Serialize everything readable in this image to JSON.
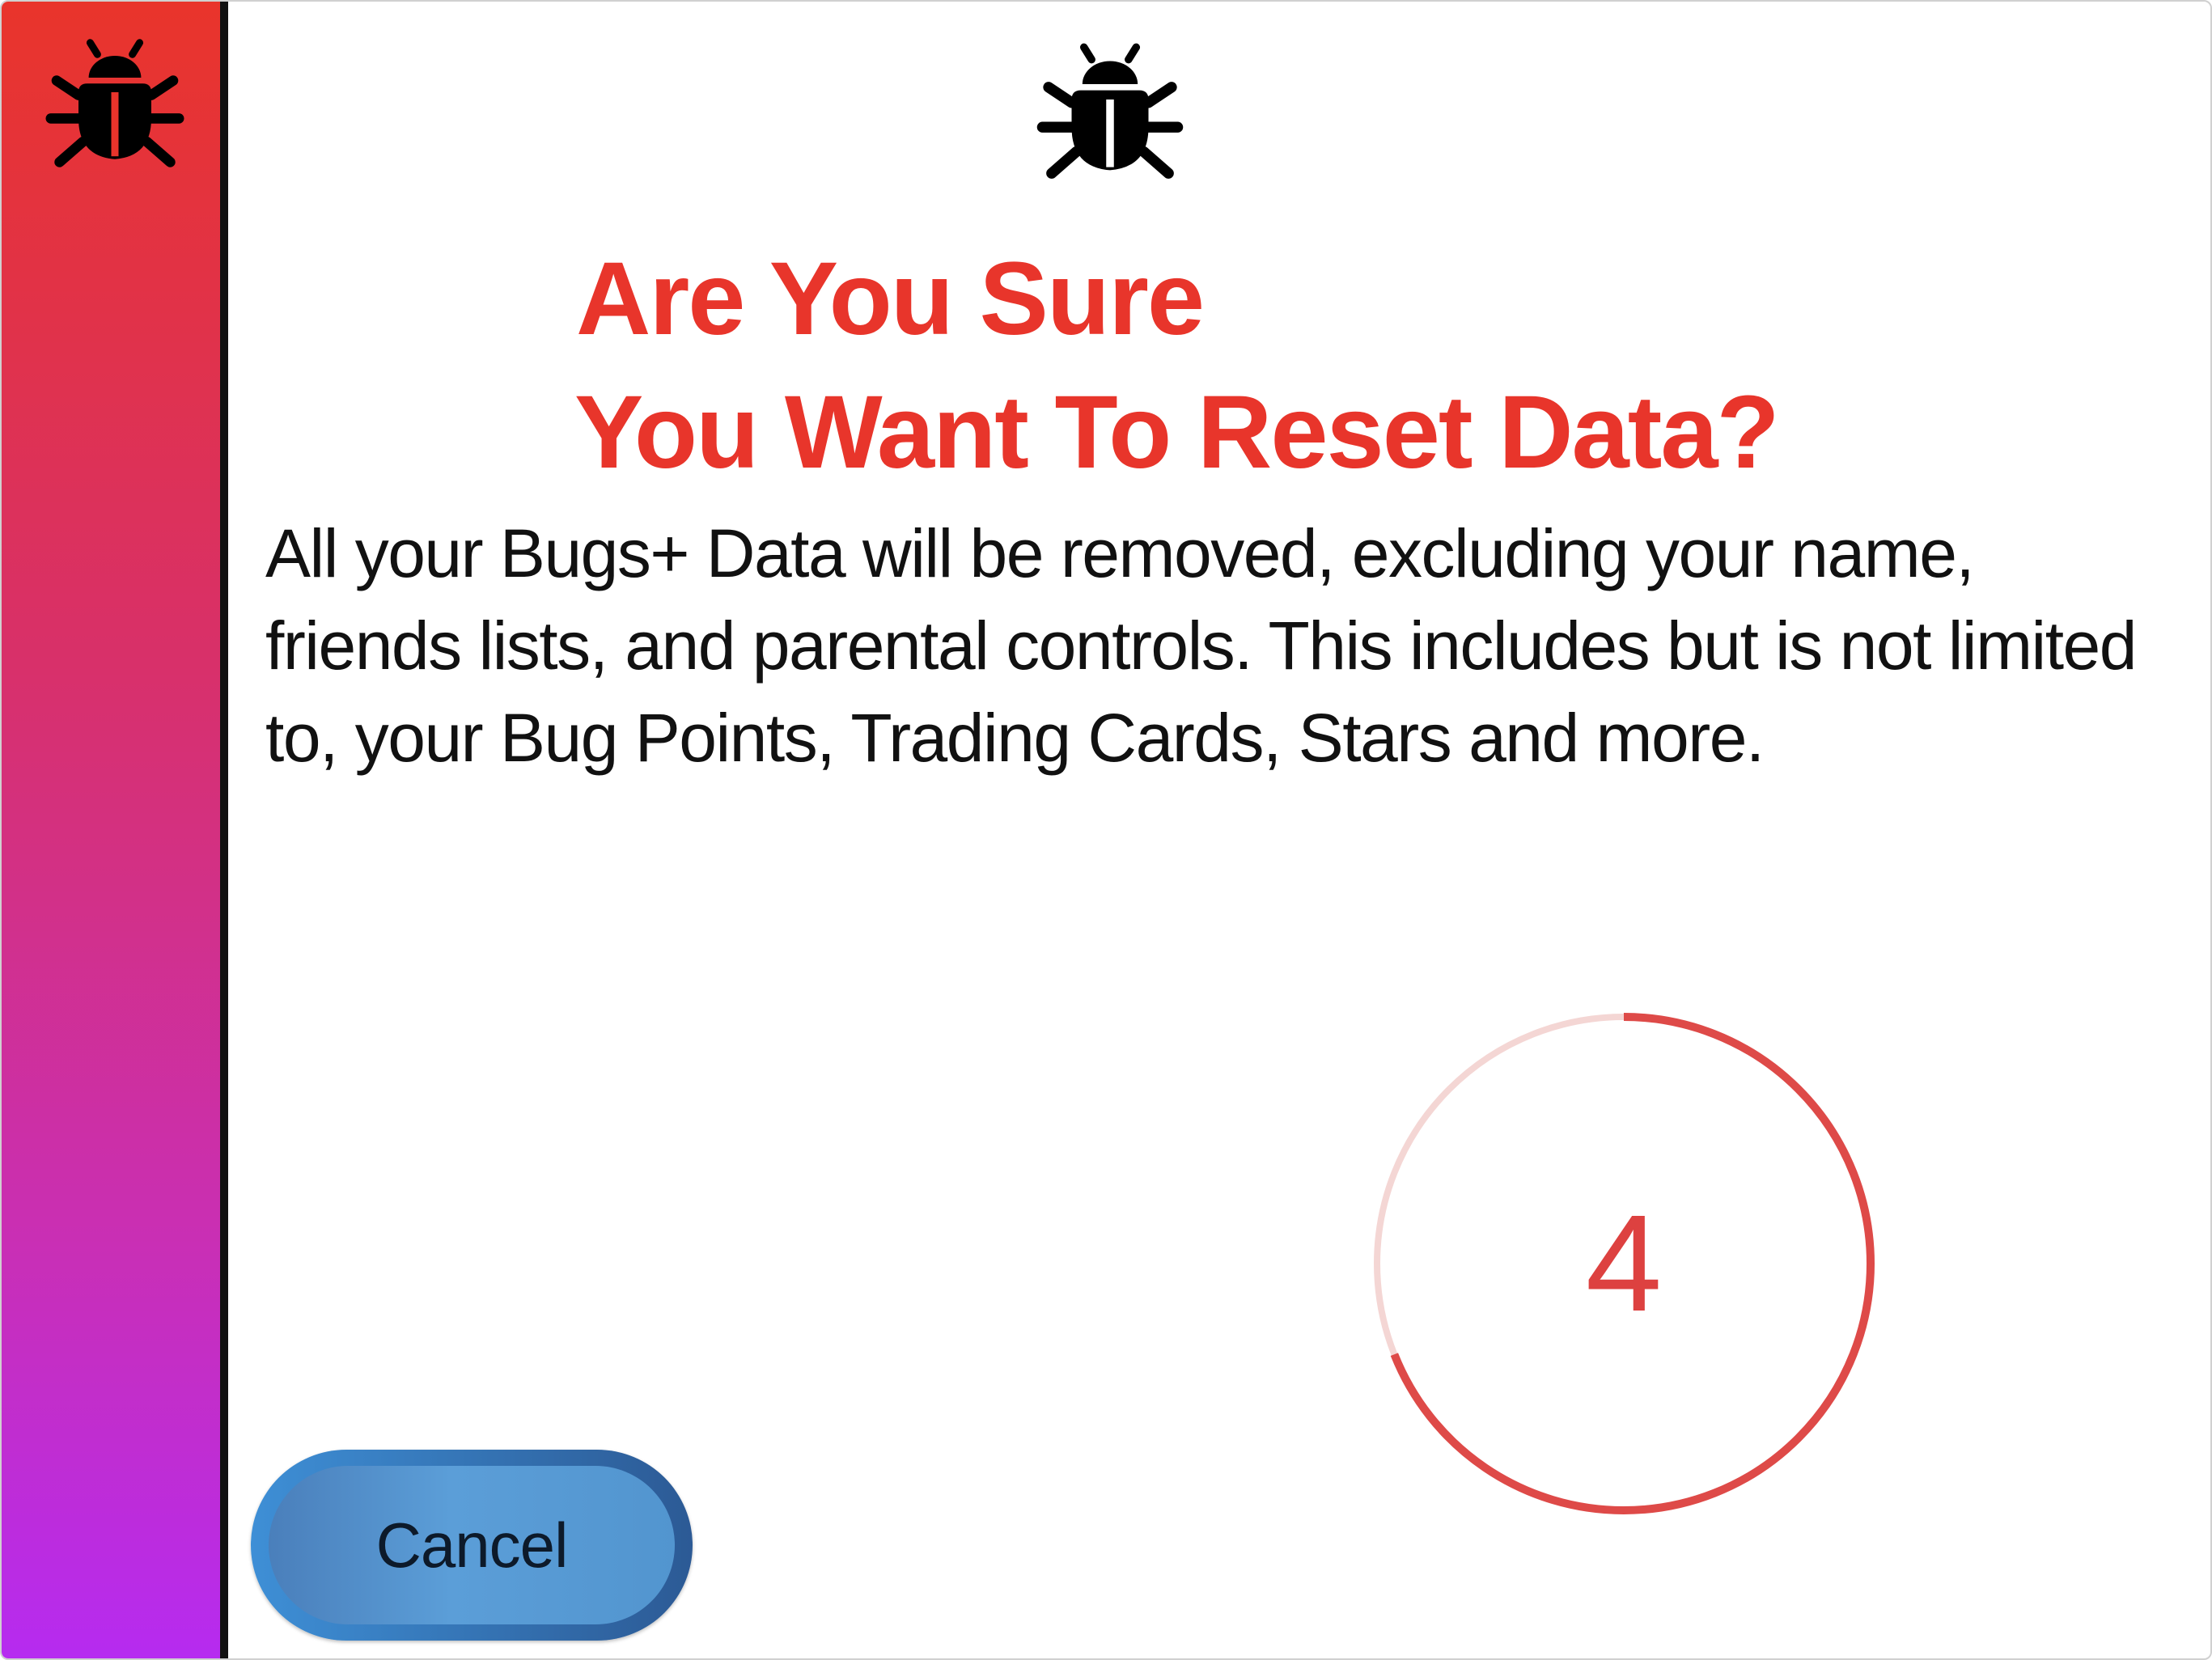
{
  "colors": {
    "accent_red": "#e8352b",
    "sidebar_gradient_top": "#e9342b",
    "sidebar_gradient_bottom": "#b62bf0",
    "button_blue": "#5b9ed8",
    "text": "#111111"
  },
  "sidebar": {
    "icon": "bug-icon"
  },
  "header": {
    "icon": "bug-icon"
  },
  "dialog": {
    "title_line1": "Are You Sure",
    "title_line2": "You Want To Reset Data?",
    "message": "All your Bugs+ Data will be removed, excluding your name, friends lists, and parental controls. This includes but is not limited to, your Bug Points, Trading Cards, Stars and more."
  },
  "countdown": {
    "value": "4",
    "progress_fraction": 0.69
  },
  "actions": {
    "cancel_label": "Cancel"
  }
}
